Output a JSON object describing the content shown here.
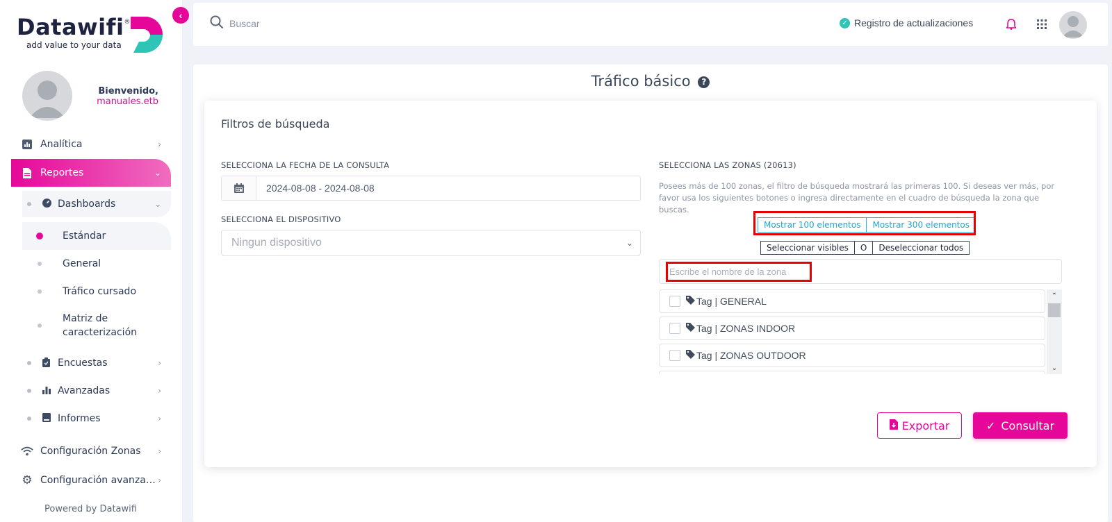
{
  "brand": {
    "name": "Datawifi",
    "registered": "®",
    "tagline": "add value to your data",
    "accent_color": "#e6079a",
    "teal_color": "#2ec4b6"
  },
  "sidebar": {
    "welcome_label": "Bienvenido,",
    "username": "manuales.etb",
    "items": [
      {
        "label": "Analítica",
        "icon": "bar-chart-icon"
      },
      {
        "label": "Reportes",
        "icon": "document-icon",
        "active": true
      },
      {
        "label": "Configuración Zonas",
        "icon": "wifi-icon"
      },
      {
        "label": "Configuración avanza…",
        "icon": "gear-icon"
      }
    ],
    "reportes_children": [
      {
        "label": "Dashboards",
        "icon": "speedometer-icon"
      },
      {
        "label": "Encuestas",
        "icon": "clipboard-icon"
      },
      {
        "label": "Avanzadas",
        "icon": "bar-chart-icon"
      },
      {
        "label": "Informes",
        "icon": "book-icon"
      }
    ],
    "dashboards_children": [
      {
        "label": "Estándar",
        "selected": true
      },
      {
        "label": "General"
      },
      {
        "label": "Tráfico cursado"
      },
      {
        "label": "Matriz de caracterización"
      }
    ],
    "powered_by": "Powered by Datawifi"
  },
  "topbar": {
    "search_placeholder": "Buscar",
    "updates_label": "Registro de actualizaciones"
  },
  "page": {
    "title": "Tráfico básico",
    "filters_title": "Filtros de búsqueda",
    "date_label": "SELECCIONA LA FECHA DE LA CONSULTA",
    "date_value": "2024-08-08 - 2024-08-08",
    "device_label": "SELECCIONA EL DISPOSITIVO",
    "device_value": "Ningun dispositivo",
    "zones_label": "SELECCIONA LAS ZONAS (20613)",
    "zones_info": "Posees más de 100 zonas, el filtro de búsqueda mostrará las primeras 100. Si deseas ver más, por favor usa los siguientes botones o ingresa directamente en el cuadro de búsqueda la zona que buscas.",
    "show_100": "Mostrar 100 elementos",
    "show_300": "Mostrar 300 elementos",
    "select_visible": "Seleccionar visibles",
    "or_label": "O",
    "deselect_all": "Deseleccionar todos",
    "zone_search_placeholder": "Escribe el nombre de la zona",
    "zones": [
      {
        "label": "Tag | GENERAL"
      },
      {
        "label": "Tag | ZONAS INDOOR"
      },
      {
        "label": "Tag | ZONAS OUTDOOR"
      }
    ],
    "export_label": "Exportar",
    "consult_label": "Consultar"
  }
}
